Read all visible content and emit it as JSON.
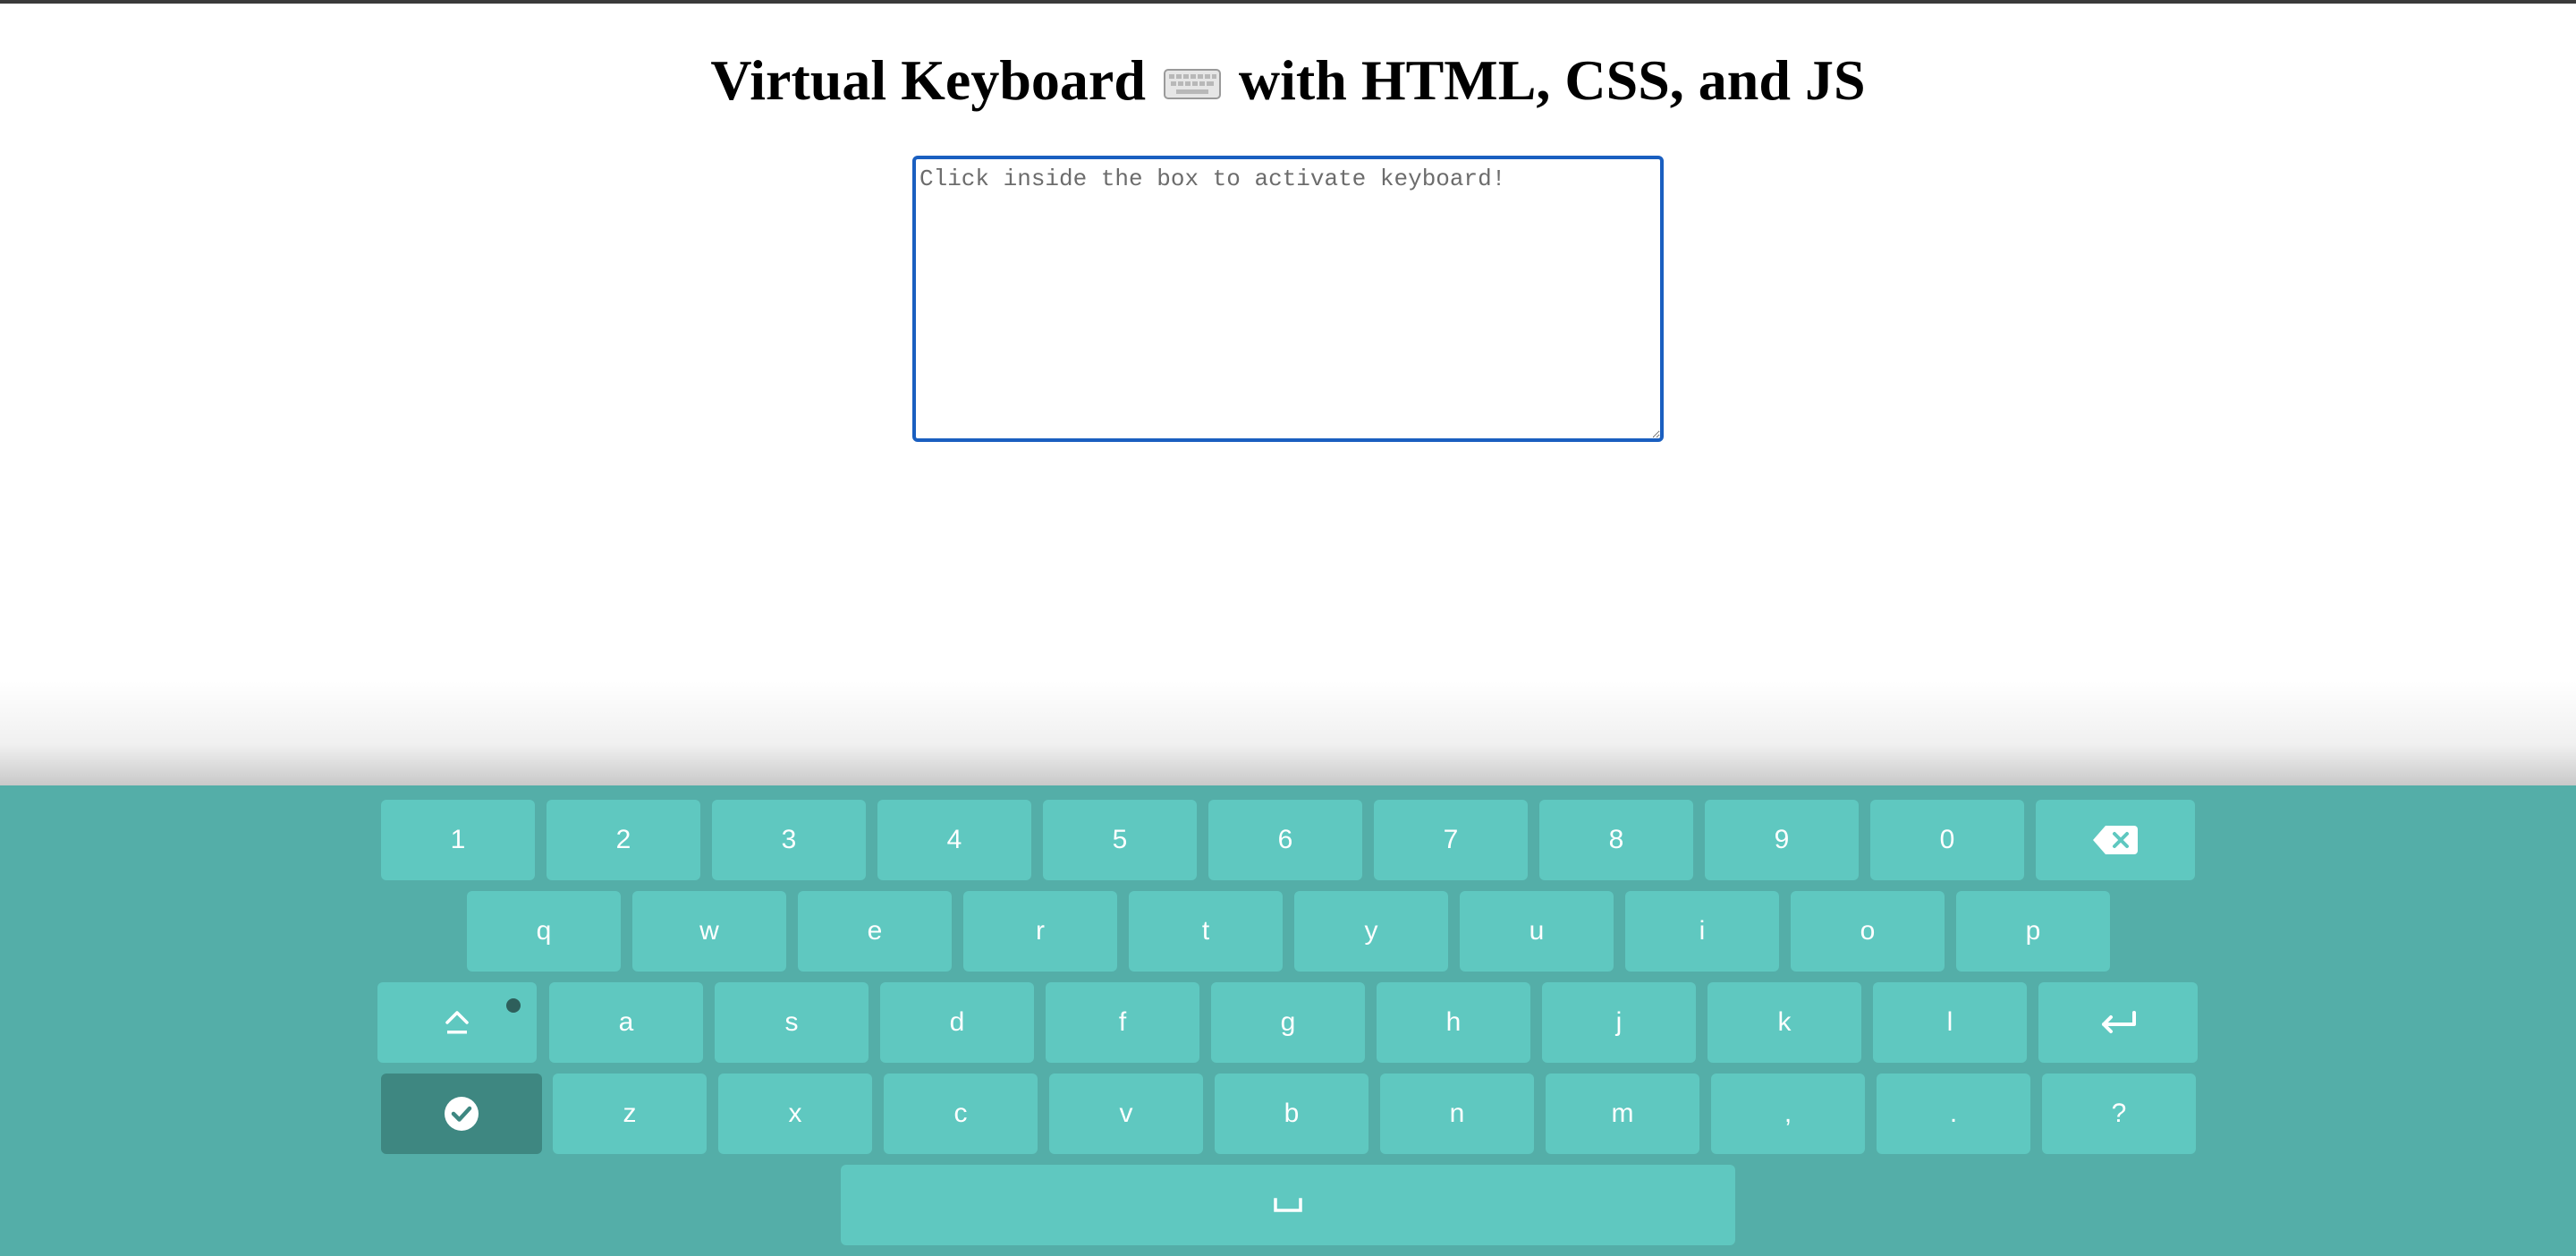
{
  "page": {
    "title_part1": "Virtual Keyboard",
    "title_part2": "with HTML, CSS, and JS"
  },
  "textarea": {
    "placeholder": "Click inside the box to activate keyboard!",
    "value": ""
  },
  "keyboard": {
    "row1": [
      "1",
      "2",
      "3",
      "4",
      "5",
      "6",
      "7",
      "8",
      "9",
      "0"
    ],
    "row2": [
      "q",
      "w",
      "e",
      "r",
      "t",
      "y",
      "u",
      "i",
      "o",
      "p"
    ],
    "row3": [
      "a",
      "s",
      "d",
      "f",
      "g",
      "h",
      "j",
      "k",
      "l"
    ],
    "row4": [
      "z",
      "x",
      "c",
      "v",
      "b",
      "n",
      "m",
      ",",
      ".",
      "?"
    ],
    "icons": {
      "backspace": "backspace-icon",
      "caps": "caps-lock-icon",
      "enter": "enter-icon",
      "done": "done-check-icon",
      "space": "space-icon"
    },
    "caps_active": false
  },
  "colors": {
    "keyboard_bg": "#54aea8",
    "key_bg": "#5fc8c0",
    "key_dark_bg": "#3e8781",
    "key_text": "#ffffff",
    "textarea_border": "#1a5fc0"
  }
}
